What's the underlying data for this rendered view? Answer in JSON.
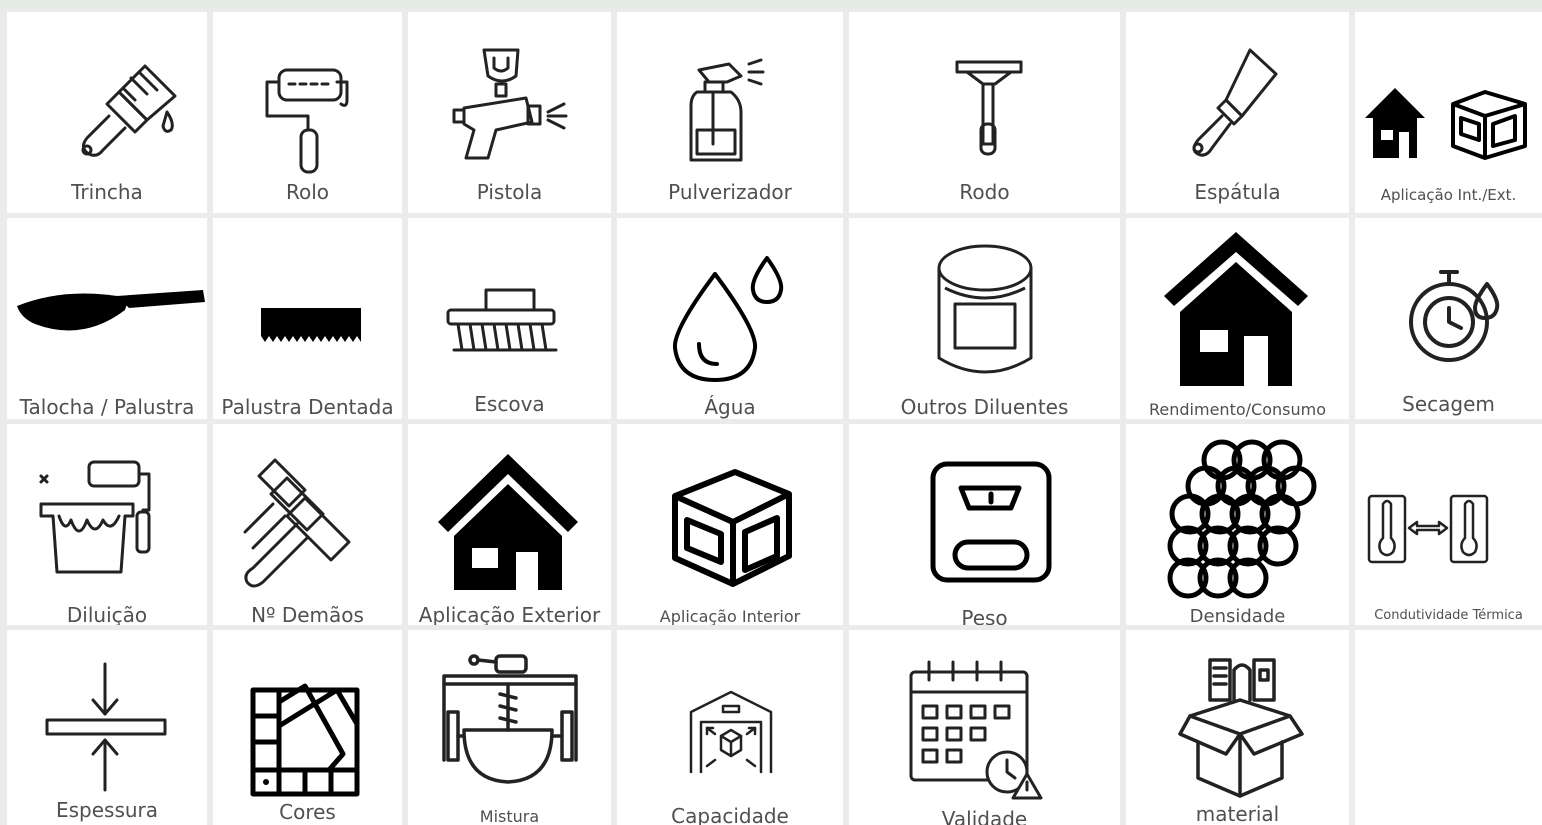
{
  "icon_library": {
    "rows": [
      [
        {
          "label": "Trincha",
          "icon": "paint-brush-icon"
        },
        {
          "label": "Rolo",
          "icon": "paint-roller-icon"
        },
        {
          "label": "Pistola",
          "icon": "spray-gun-icon"
        },
        {
          "label": "Pulverizador",
          "icon": "spray-bottle-icon"
        },
        {
          "label": "Rodo",
          "icon": "squeegee-icon"
        },
        {
          "label": "Espátula",
          "icon": "spatula-icon"
        },
        {
          "label": "Aplicação Int./Ext.",
          "icon": "interior-exterior-icon"
        }
      ],
      [
        {
          "label": "Talocha / Palustra",
          "icon": "trowel-icon"
        },
        {
          "label": "Palustra Dentada",
          "icon": "notched-trowel-icon"
        },
        {
          "label": "Escova",
          "icon": "scrub-brush-icon"
        },
        {
          "label": "Água",
          "icon": "water-drops-icon"
        },
        {
          "label": "Outros Diluentes",
          "icon": "thinner-can-icon"
        },
        {
          "label": "Rendimento/Consumo",
          "icon": "house-icon"
        },
        {
          "label": "Secagem",
          "icon": "drying-timer-icon"
        }
      ],
      [
        {
          "label": "Diluição",
          "icon": "paint-bucket-roller-icon"
        },
        {
          "label": "Nº Demãos",
          "icon": "paint-coats-icon"
        },
        {
          "label": "Aplicação Exterior",
          "icon": "exterior-house-icon"
        },
        {
          "label": "Aplicação Interior",
          "icon": "interior-room-icon"
        },
        {
          "label": "Peso",
          "icon": "weight-scale-icon"
        },
        {
          "label": "Densidade",
          "icon": "density-spheres-icon"
        },
        {
          "label": "Condutividade Térmica",
          "icon": "thermal-conductivity-icon"
        }
      ],
      [
        {
          "label": "Espessura",
          "icon": "thickness-icon"
        },
        {
          "label": "Cores",
          "icon": "color-swatches-icon"
        },
        {
          "label": "Mistura",
          "icon": "mixer-icon"
        },
        {
          "label": "Capacidade",
          "icon": "capacity-warehouse-icon"
        },
        {
          "label": "Validade",
          "icon": "expiry-calendar-icon"
        },
        {
          "label": "material",
          "icon": "material-box-icon"
        },
        {
          "label": "",
          "icon": ""
        }
      ]
    ]
  }
}
